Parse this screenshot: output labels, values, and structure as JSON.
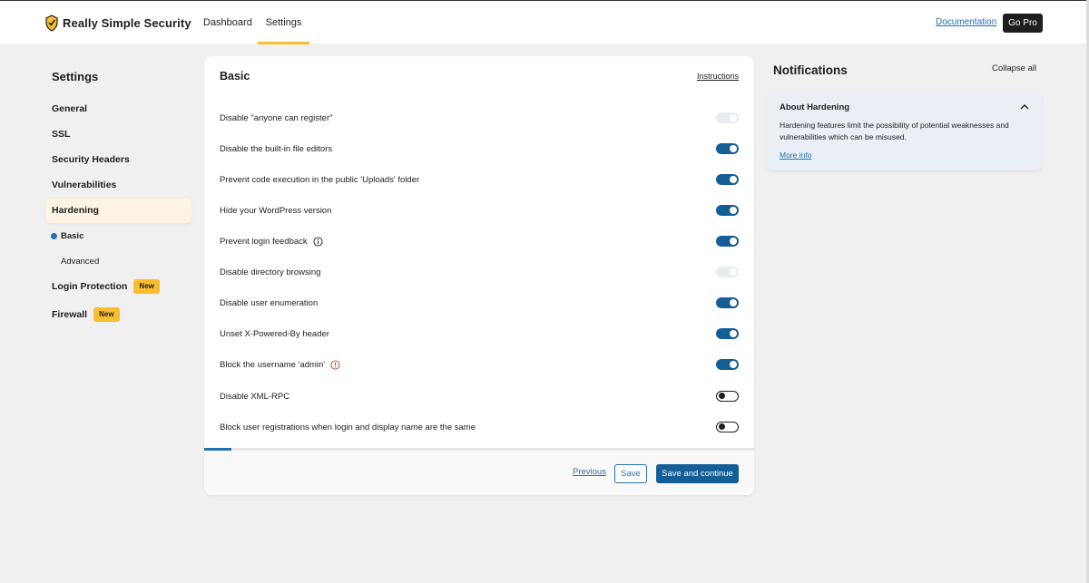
{
  "header": {
    "logo_text": "Really Simple Security",
    "tabs": [
      {
        "label": "Dashboard"
      },
      {
        "label": "Settings",
        "active": true
      }
    ],
    "documentation_label": "Documentation",
    "go_pro_label": "Go Pro"
  },
  "sidebar": {
    "title": "Settings",
    "items": [
      {
        "label": "General"
      },
      {
        "label": "SSL"
      },
      {
        "label": "Security Headers"
      },
      {
        "label": "Vulnerabilities"
      },
      {
        "label": "Hardening",
        "active": true
      },
      {
        "label": "Login Protection",
        "badge": "New"
      },
      {
        "label": "Firewall",
        "badge": "New"
      }
    ],
    "subitems": [
      {
        "label": "Basic",
        "current": true
      },
      {
        "label": "Advanced"
      }
    ]
  },
  "panel": {
    "title": "Basic",
    "instructions_label": "Instructions",
    "settings": [
      {
        "label": "Disable \"anyone can register\"",
        "state": "disabled"
      },
      {
        "label": "Disable the built-in file editors",
        "state": "on"
      },
      {
        "label": "Prevent code execution in the public 'Uploads' folder",
        "state": "on"
      },
      {
        "label": "Hide your WordPress version",
        "state": "on"
      },
      {
        "label": "Prevent login feedback",
        "state": "on",
        "icon": "info-icon"
      },
      {
        "label": "Disable directory browsing",
        "state": "disabled"
      },
      {
        "label": "Disable user enumeration",
        "state": "on"
      },
      {
        "label": "Unset X-Powered-By header",
        "state": "on"
      },
      {
        "label": "Block the username 'admin'",
        "state": "on",
        "icon": "warning-icon"
      },
      {
        "label": "Disable XML-RPC",
        "state": "off"
      },
      {
        "label": "Block user registrations when login and display name are the same",
        "state": "off"
      }
    ],
    "progress": 0.05,
    "previous_label": "Previous",
    "save_label": "Save",
    "save_continue_label": "Save and continue"
  },
  "notifications": {
    "title": "Notifications",
    "collapse_all_label": "Collapse all",
    "card": {
      "title": "About Hardening",
      "text": "Hardening features limit the possibility of potential weaknesses and vulnerabilities which can be misused.",
      "more_info_label": "More info"
    }
  },
  "colors": {
    "accent": "#2271b1",
    "toggle_on": "#135e96",
    "brand_yellow": "#f8be2e",
    "warning_red": "#d63638"
  }
}
